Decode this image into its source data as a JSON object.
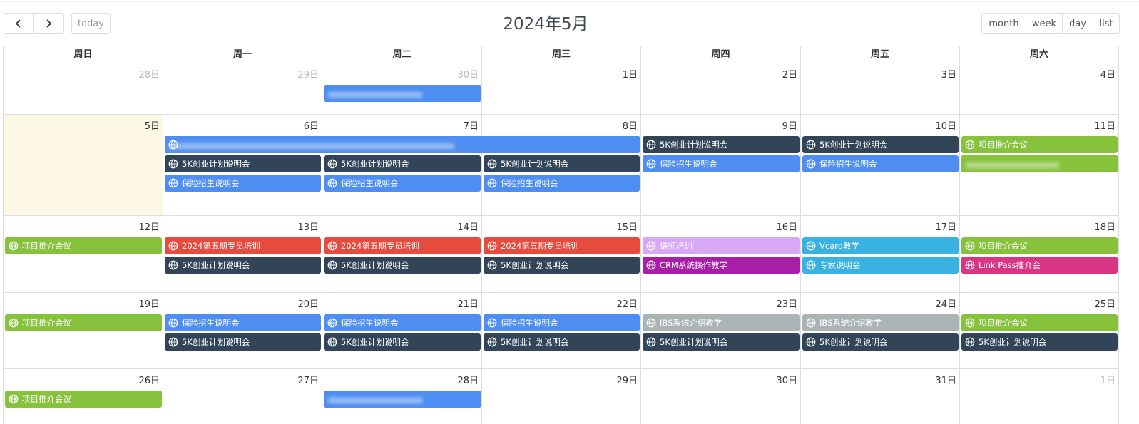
{
  "toolbar": {
    "prev_icon": "chevron-left-icon",
    "next_icon": "chevron-right-icon",
    "today_label": "today",
    "title": "2024年5月",
    "views": [
      "month",
      "week",
      "day",
      "list"
    ]
  },
  "weekdays": [
    "周日",
    "周一",
    "周二",
    "周三",
    "周四",
    "周五",
    "周六"
  ],
  "colors": {
    "blue": "#4e8df1",
    "navy": "#324558",
    "green": "#86c23c",
    "red": "#e64c3d",
    "lavender": "#d8a8f5",
    "purple": "#a91ea6",
    "cyan": "#39b2e1",
    "pink": "#d93585",
    "gray": "#abb4b5",
    "today_bg": "#fcf8e3"
  },
  "weeks": [
    {
      "days": [
        "28日",
        "29日",
        "30日",
        "1日",
        "2日",
        "3日",
        "4日"
      ],
      "other": [
        true,
        true,
        true,
        false,
        false,
        false,
        false
      ],
      "today": [
        false,
        false,
        false,
        false,
        false,
        false,
        false
      ],
      "events": [
        {
          "start": 2,
          "span": 1,
          "row": 0,
          "color": "blue",
          "title": "",
          "icon": false,
          "redacted": true
        }
      ]
    },
    {
      "days": [
        "5日",
        "6日",
        "7日",
        "8日",
        "9日",
        "10日",
        "11日"
      ],
      "other": [
        false,
        false,
        false,
        false,
        false,
        false,
        false
      ],
      "today": [
        true,
        false,
        false,
        false,
        false,
        false,
        false
      ],
      "events": [
        {
          "start": 1,
          "span": 3,
          "row": 0,
          "color": "blue",
          "title": "",
          "icon": true,
          "redacted": true
        },
        {
          "start": 4,
          "span": 1,
          "row": 0,
          "color": "navy",
          "title": "5K创业计划说明会",
          "icon": true
        },
        {
          "start": 5,
          "span": 1,
          "row": 0,
          "color": "navy",
          "title": "5K创业计划说明会",
          "icon": true
        },
        {
          "start": 6,
          "span": 1,
          "row": 0,
          "color": "green",
          "title": "项目推介会议",
          "icon": true
        },
        {
          "start": 1,
          "span": 1,
          "row": 1,
          "color": "navy",
          "title": "5K创业计划说明会",
          "icon": true
        },
        {
          "start": 2,
          "span": 1,
          "row": 1,
          "color": "navy",
          "title": "5K创业计划说明会",
          "icon": true
        },
        {
          "start": 3,
          "span": 1,
          "row": 1,
          "color": "navy",
          "title": "5K创业计划说明会",
          "icon": true
        },
        {
          "start": 4,
          "span": 1,
          "row": 1,
          "color": "blue",
          "title": "保险招生说明会",
          "icon": true
        },
        {
          "start": 5,
          "span": 1,
          "row": 1,
          "color": "blue",
          "title": "保险招生说明会",
          "icon": true
        },
        {
          "start": 6,
          "span": 1,
          "row": 1,
          "color": "green",
          "title": "",
          "icon": false,
          "redacted": true
        },
        {
          "start": 1,
          "span": 1,
          "row": 2,
          "color": "blue",
          "title": "保险招生说明会",
          "icon": true
        },
        {
          "start": 2,
          "span": 1,
          "row": 2,
          "color": "blue",
          "title": "保险招生说明会",
          "icon": true
        },
        {
          "start": 3,
          "span": 1,
          "row": 2,
          "color": "blue",
          "title": "保险招生说明会",
          "icon": true
        }
      ]
    },
    {
      "days": [
        "12日",
        "13日",
        "14日",
        "15日",
        "16日",
        "17日",
        "18日"
      ],
      "other": [
        false,
        false,
        false,
        false,
        false,
        false,
        false
      ],
      "today": [
        false,
        false,
        false,
        false,
        false,
        false,
        false
      ],
      "events": [
        {
          "start": 0,
          "span": 1,
          "row": 0,
          "color": "green",
          "title": "项目推介会议",
          "icon": true
        },
        {
          "start": 1,
          "span": 1,
          "row": 0,
          "color": "red",
          "title": "2024第五期专员培训",
          "icon": true
        },
        {
          "start": 2,
          "span": 1,
          "row": 0,
          "color": "red",
          "title": "2024第五期专员培训",
          "icon": true
        },
        {
          "start": 3,
          "span": 1,
          "row": 0,
          "color": "red",
          "title": "2024第五期专员培训",
          "icon": true
        },
        {
          "start": 4,
          "span": 1,
          "row": 0,
          "color": "lavender",
          "title": "讲师培训",
          "icon": true
        },
        {
          "start": 5,
          "span": 1,
          "row": 0,
          "color": "cyan",
          "title": "Vcard教学",
          "icon": true
        },
        {
          "start": 6,
          "span": 1,
          "row": 0,
          "color": "green",
          "title": "项目推介会议",
          "icon": true
        },
        {
          "start": 1,
          "span": 1,
          "row": 1,
          "color": "navy",
          "title": "5K创业计划说明会",
          "icon": true
        },
        {
          "start": 2,
          "span": 1,
          "row": 1,
          "color": "navy",
          "title": "5K创业计划说明会",
          "icon": true
        },
        {
          "start": 3,
          "span": 1,
          "row": 1,
          "color": "navy",
          "title": "5K创业计划说明会",
          "icon": true
        },
        {
          "start": 4,
          "span": 1,
          "row": 1,
          "color": "purple",
          "title": "CRM系统操作教学",
          "icon": true
        },
        {
          "start": 5,
          "span": 1,
          "row": 1,
          "color": "cyan",
          "title": "专家说明会",
          "icon": true
        },
        {
          "start": 6,
          "span": 1,
          "row": 1,
          "color": "pink",
          "title": "Link Pass推介会",
          "icon": true
        }
      ]
    },
    {
      "days": [
        "19日",
        "20日",
        "21日",
        "22日",
        "23日",
        "24日",
        "25日"
      ],
      "other": [
        false,
        false,
        false,
        false,
        false,
        false,
        false
      ],
      "today": [
        false,
        false,
        false,
        false,
        false,
        false,
        false
      ],
      "events": [
        {
          "start": 0,
          "span": 1,
          "row": 0,
          "color": "green",
          "title": "项目推介会议",
          "icon": true
        },
        {
          "start": 1,
          "span": 1,
          "row": 0,
          "color": "blue",
          "title": "保险招生说明会",
          "icon": true
        },
        {
          "start": 2,
          "span": 1,
          "row": 0,
          "color": "blue",
          "title": "保险招生说明会",
          "icon": true
        },
        {
          "start": 3,
          "span": 1,
          "row": 0,
          "color": "blue",
          "title": "保险招生说明会",
          "icon": true
        },
        {
          "start": 4,
          "span": 1,
          "row": 0,
          "color": "gray",
          "title": "IBS系统介绍教学",
          "icon": true
        },
        {
          "start": 5,
          "span": 1,
          "row": 0,
          "color": "gray",
          "title": "IBS系统介绍教学",
          "icon": true
        },
        {
          "start": 6,
          "span": 1,
          "row": 0,
          "color": "green",
          "title": "项目推介会议",
          "icon": true
        },
        {
          "start": 1,
          "span": 1,
          "row": 1,
          "color": "navy",
          "title": "5K创业计划说明会",
          "icon": true
        },
        {
          "start": 2,
          "span": 1,
          "row": 1,
          "color": "navy",
          "title": "5K创业计划说明会",
          "icon": true
        },
        {
          "start": 3,
          "span": 1,
          "row": 1,
          "color": "navy",
          "title": "5K创业计划说明会",
          "icon": true
        },
        {
          "start": 4,
          "span": 1,
          "row": 1,
          "color": "navy",
          "title": "5K创业计划说明会",
          "icon": true
        },
        {
          "start": 5,
          "span": 1,
          "row": 1,
          "color": "navy",
          "title": "5K创业计划说明会",
          "icon": true
        },
        {
          "start": 6,
          "span": 1,
          "row": 1,
          "color": "navy",
          "title": "5K创业计划说明会",
          "icon": true
        }
      ]
    },
    {
      "days": [
        "26日",
        "27日",
        "28日",
        "29日",
        "30日",
        "31日",
        "1日"
      ],
      "other": [
        false,
        false,
        false,
        false,
        false,
        false,
        true
      ],
      "today": [
        false,
        false,
        false,
        false,
        false,
        false,
        false
      ],
      "events": [
        {
          "start": 0,
          "span": 1,
          "row": 0,
          "color": "green",
          "title": "项目推介会议",
          "icon": true
        },
        {
          "start": 2,
          "span": 1,
          "row": 0,
          "color": "blue",
          "title": "",
          "icon": false,
          "redacted": true
        }
      ]
    }
  ]
}
